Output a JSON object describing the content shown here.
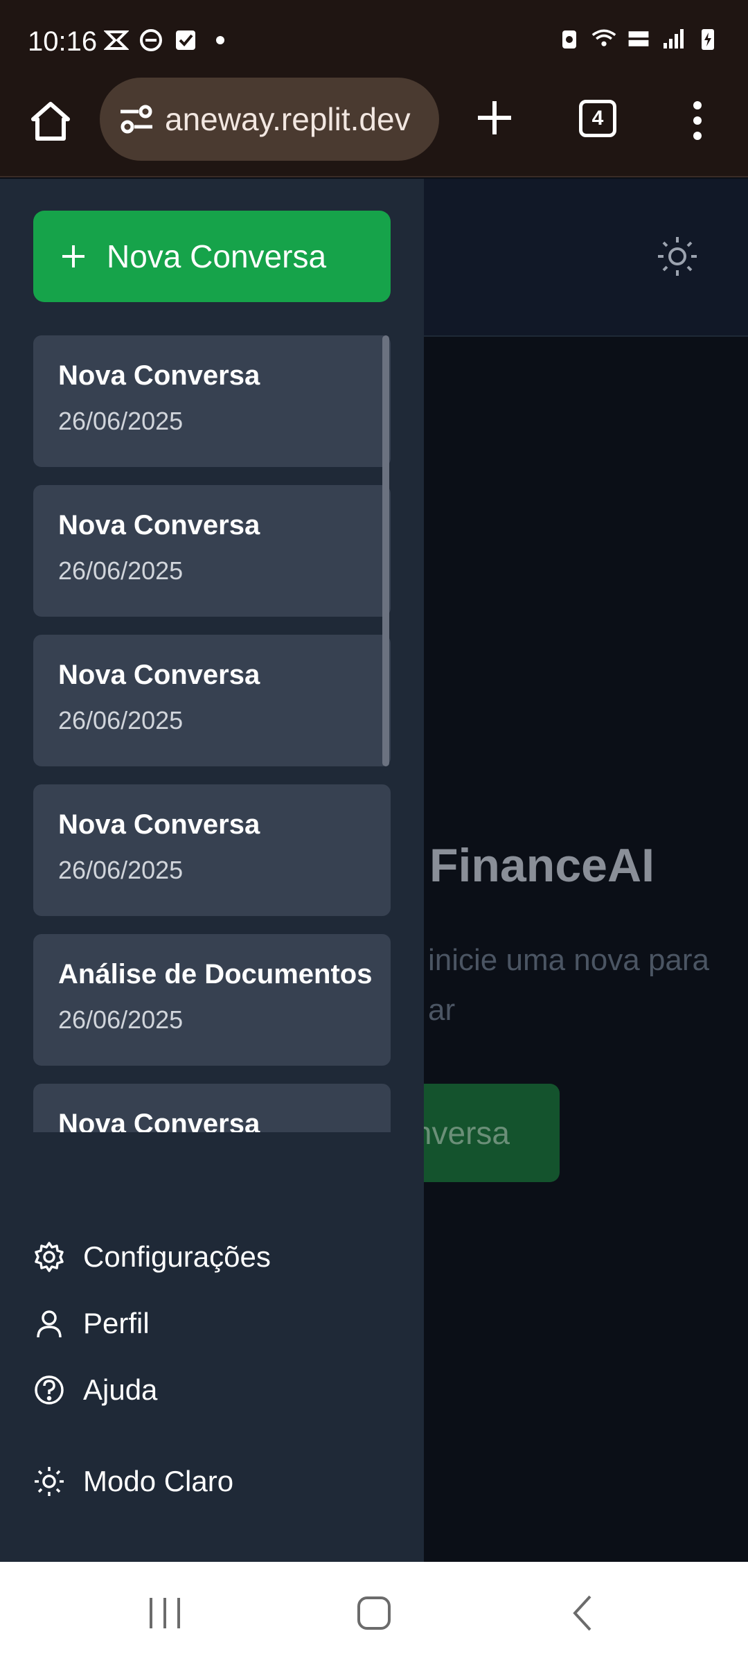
{
  "status_bar": {
    "time": "10:16"
  },
  "browser": {
    "url": "aneway.replit.dev",
    "tab_count": "4"
  },
  "background": {
    "title": "FinanceAI",
    "subtitle_line1": "inicie uma nova para",
    "subtitle_line2": "ar",
    "button_label": "nversa"
  },
  "drawer": {
    "new_chat_label": "Nova Conversa",
    "conversations": [
      {
        "title": "Nova Conversa",
        "date": "26/06/2025"
      },
      {
        "title": "Nova Conversa",
        "date": "26/06/2025"
      },
      {
        "title": "Nova Conversa",
        "date": "26/06/2025"
      },
      {
        "title": "Nova Conversa",
        "date": "26/06/2025"
      },
      {
        "title": "Análise de Documentos",
        "date": "26/06/2025"
      },
      {
        "title": "Nova Conversa",
        "date": ""
      }
    ],
    "menu": {
      "settings": "Configurações",
      "profile": "Perfil",
      "help": "Ajuda",
      "theme": "Modo Claro"
    }
  },
  "colors": {
    "accent_green": "#16a34a",
    "drawer_bg": "#1f2937",
    "card_bg": "#374151"
  }
}
